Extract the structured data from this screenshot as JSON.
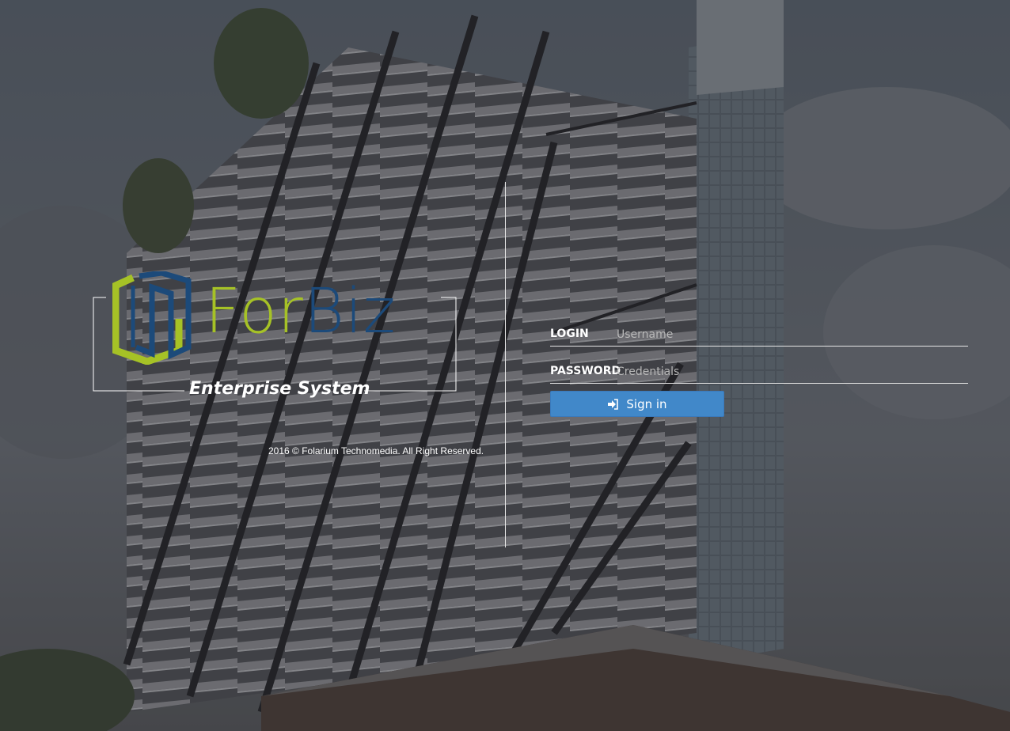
{
  "brand": {
    "word_part1": "For",
    "word_part2": "Biz",
    "subtitle": "Enterprise System",
    "colors": {
      "green": "#a6c226",
      "blue": "#1c4a7a"
    }
  },
  "footer": {
    "copyright": "2016 © Folarium Technomedia. All Right Reserved."
  },
  "login": {
    "login_label": "LOGIN",
    "username_placeholder": "Username",
    "password_label": "PASSWORD",
    "password_placeholder": "Credentials",
    "signin_label": "Sign in",
    "button_color": "#4188c9"
  }
}
